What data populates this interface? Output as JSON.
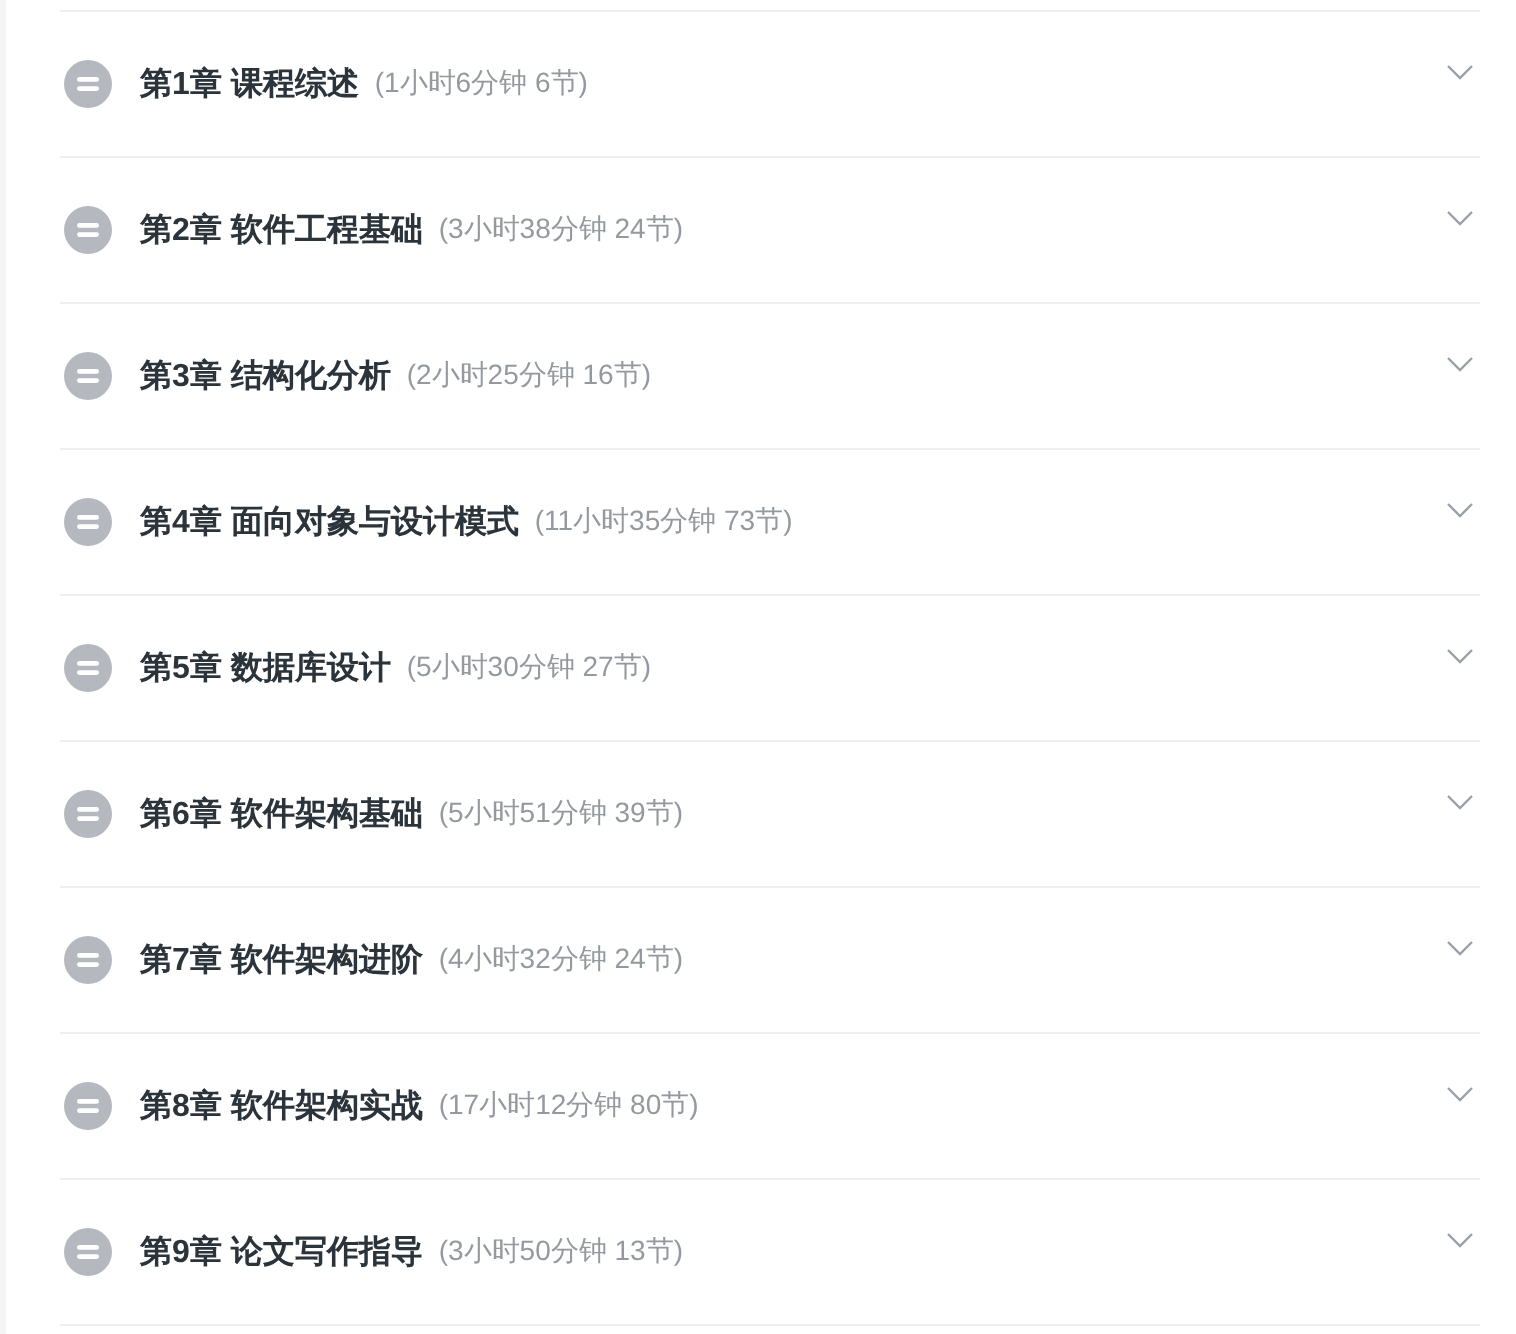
{
  "chapters": [
    {
      "title": "第1章 课程综述",
      "duration": "(1小时6分钟 6节)",
      "expanded": false
    },
    {
      "title": "第2章 软件工程基础",
      "duration": "(3小时38分钟 24节)",
      "expanded": false
    },
    {
      "title": "第3章 结构化分析",
      "duration": "(2小时25分钟 16节)",
      "expanded": false
    },
    {
      "title": "第4章 面向对象与设计模式",
      "duration": "(11小时35分钟 73节)",
      "expanded": false
    },
    {
      "title": "第5章 数据库设计",
      "duration": "(5小时30分钟 27节)",
      "expanded": false
    },
    {
      "title": "第6章 软件架构基础",
      "duration": "(5小时51分钟 39节)",
      "expanded": false
    },
    {
      "title": "第7章 软件架构进阶",
      "duration": "(4小时32分钟 24节)",
      "expanded": false
    },
    {
      "title": "第8章 软件架构实战",
      "duration": "(17小时12分钟 80节)",
      "expanded": false
    },
    {
      "title": "第9章 论文写作指导",
      "duration": "(3小时50分钟 13节)",
      "expanded": false
    }
  ]
}
